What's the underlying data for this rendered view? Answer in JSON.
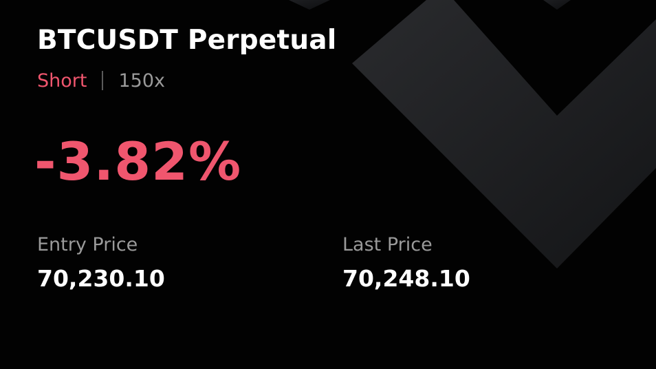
{
  "position": {
    "symbol_title": "BTCUSDT Perpetual",
    "side": "Short",
    "leverage": "150x",
    "pnl_percent": "-3.82%"
  },
  "stats": {
    "entry_label": "Entry Price",
    "entry_value": "70,230.10",
    "last_label": "Last Price",
    "last_value": "70,248.10"
  },
  "colors": {
    "background": "#020202",
    "negative": "#f0566e",
    "muted": "#9a9a9a",
    "text": "#ffffff",
    "logo_shape": "#1d1e20"
  },
  "icons": {
    "background_logo": "chevron-logo-icon"
  }
}
